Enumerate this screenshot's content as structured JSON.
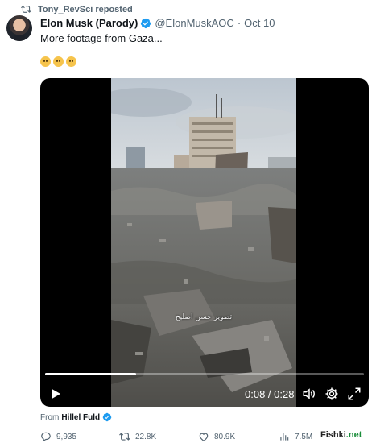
{
  "repost": {
    "label": "Tony_RevSci reposted",
    "icon": "repost-icon"
  },
  "author": {
    "name": "Elon Musk (Parody)",
    "handle": "@ElonMuskAOC",
    "separator": "·",
    "date": "Oct 10",
    "verified_color": "#1d9bf0"
  },
  "tweet": {
    "text": "More footage from Gaza...",
    "emojis": [
      "😶",
      "😶",
      "😶"
    ]
  },
  "video": {
    "overlay_caption": "تصوير حسن اصليح",
    "time": "0:08 / 0:28",
    "progress": 0.286,
    "controls": [
      "play-icon",
      "volume-icon",
      "settings-icon",
      "fullscreen-icon"
    ]
  },
  "attribution": {
    "prefix": "From",
    "account": "Hillel Fuld"
  },
  "actions": {
    "replies": "9,935",
    "reposts": "22.8K",
    "likes": "80.9K",
    "views": "7.5M"
  },
  "watermark": {
    "text": "Fishki",
    "tld": ".net"
  }
}
